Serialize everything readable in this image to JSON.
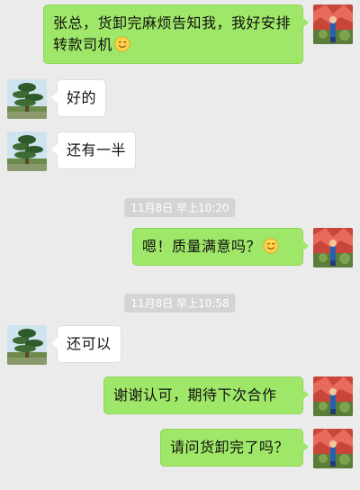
{
  "messages": [
    {
      "side": "out",
      "text": "张总，货卸完麻烦告知我，我好安排转款司机",
      "emoji": "smile-emoji"
    },
    {
      "side": "in",
      "text": "好的"
    },
    {
      "side": "in",
      "text": "还有一半"
    },
    {
      "side": "time",
      "text": "11月8日 早上10:20"
    },
    {
      "side": "out",
      "text": "嗯！质量满意吗？",
      "emoji": "smile-emoji"
    },
    {
      "side": "time",
      "text": "11月8日 早上10:58"
    },
    {
      "side": "in",
      "text": "还可以"
    },
    {
      "side": "out",
      "text": "谢谢认可，期待下次合作"
    },
    {
      "side": "out",
      "text": "请问货卸完了吗？"
    }
  ],
  "icons": {
    "my_avatar": "avatar-image",
    "their_avatar": "tree-avatar-image",
    "emoji": "smile-emoji"
  },
  "colors": {
    "out_bubble": "#9fe768",
    "in_bubble": "#ffffff",
    "background": "#ebebeb",
    "time_pill": "#d4d4d4"
  }
}
